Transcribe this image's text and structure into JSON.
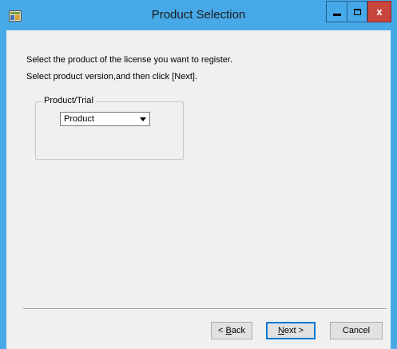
{
  "window": {
    "title": "Product Selection",
    "close_label": "x",
    "icons": {
      "app": "app-icon",
      "minimize": "minimize-icon",
      "maximize": "maximize-icon",
      "close": "close-icon"
    },
    "accent_color": "#48a9e8"
  },
  "instructions": {
    "line1": "Select the product of the license you want to register.",
    "line2": "Select product version,and then click [Next]."
  },
  "group": {
    "label": "Product/Trial",
    "select_value": "Product"
  },
  "footer": {
    "back": {
      "prefix": "< ",
      "mnemonic": "B",
      "rest": "ack"
    },
    "next": {
      "mnemonic": "N",
      "rest": "ext >"
    },
    "cancel": "Cancel"
  }
}
